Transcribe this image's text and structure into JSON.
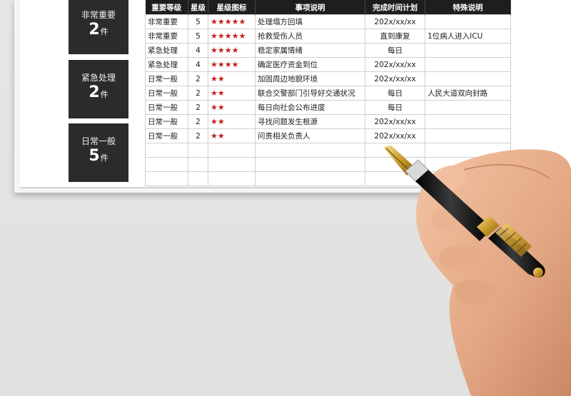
{
  "summary": [
    {
      "label": "非常重要",
      "count": "2",
      "unit": "件"
    },
    {
      "label": "紧急处理",
      "count": "2",
      "unit": "件"
    },
    {
      "label": "日常一般",
      "count": "5",
      "unit": "件"
    }
  ],
  "table": {
    "headers": [
      "重要等级",
      "星级",
      "星级图标",
      "事项说明",
      "完成时间计划",
      "特殊说明"
    ],
    "rows": [
      {
        "level": "非常重要",
        "stars": "5",
        "icons": "★★★★★",
        "item": "处理塌方回填",
        "plan": "202x/xx/xx",
        "note": ""
      },
      {
        "level": "非常重要",
        "stars": "5",
        "icons": "★★★★★",
        "item": "抢救受伤人员",
        "plan": "直到康复",
        "note": "1位病人进入ICU"
      },
      {
        "level": "紧急处理",
        "stars": "4",
        "icons": "★★★★",
        "item": "稳定家属情绪",
        "plan": "每日",
        "note": ""
      },
      {
        "level": "紧急处理",
        "stars": "4",
        "icons": "★★★★",
        "item": "确定医疗资金到位",
        "plan": "202x/xx/xx",
        "note": ""
      },
      {
        "level": "日常一般",
        "stars": "2",
        "icons": "★★",
        "item": "加固周边地貌环境",
        "plan": "202x/xx/xx",
        "note": ""
      },
      {
        "level": "日常一般",
        "stars": "2",
        "icons": "★★",
        "item": "联合交警部门引导好交通状况",
        "plan": "每日",
        "note": "人民大道双向封路"
      },
      {
        "level": "日常一般",
        "stars": "2",
        "icons": "★★",
        "item": "每日向社会公布进度",
        "plan": "每日",
        "note": ""
      },
      {
        "level": "日常一般",
        "stars": "2",
        "icons": "★★",
        "item": "寻找问题发生根源",
        "plan": "202x/xx/xx",
        "note": ""
      },
      {
        "level": "日常一般",
        "stars": "2",
        "icons": "★★",
        "item": "问责相关负责人",
        "plan": "202x/xx/xx",
        "note": ""
      }
    ]
  },
  "colors": {
    "header_bg": "#1e1e1e",
    "star": "#c0201c",
    "card_bg": "#2b2b2b"
  },
  "decoration": {
    "pen": "fountain-pen-icon",
    "hand": "hand-icon"
  }
}
